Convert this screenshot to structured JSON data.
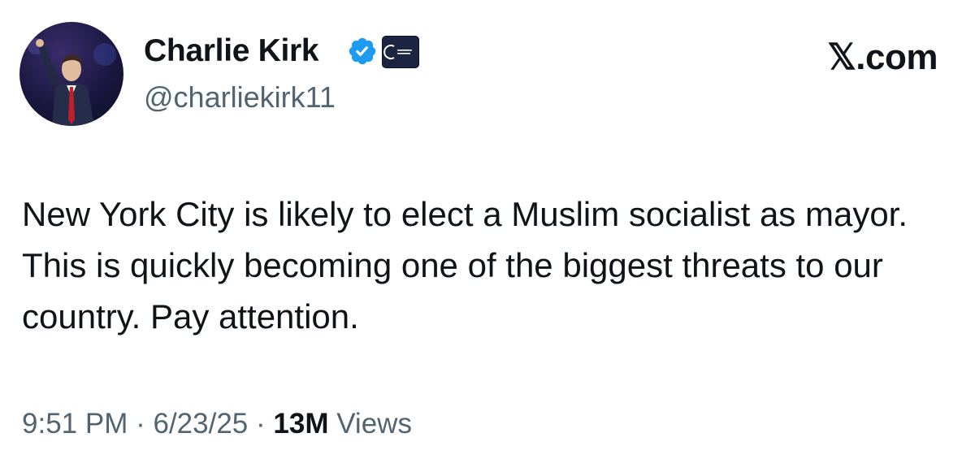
{
  "author": {
    "display_name": "Charlie Kirk",
    "handle": "@charliekirk11",
    "verified_icon": "verified-badge-icon",
    "affiliate_icon": "affiliate-logo-icon",
    "verified_color": "#1d9bf0"
  },
  "site_label": "𝕏.com",
  "tweet": {
    "text": "New York City is likely to elect a Muslim socialist as mayor. This is quickly becoming one of the biggest threats to our country. Pay attention."
  },
  "meta": {
    "time": "9:51 PM",
    "separator": "·",
    "date": "6/23/25",
    "views_count": "13M",
    "views_label": "Views"
  }
}
